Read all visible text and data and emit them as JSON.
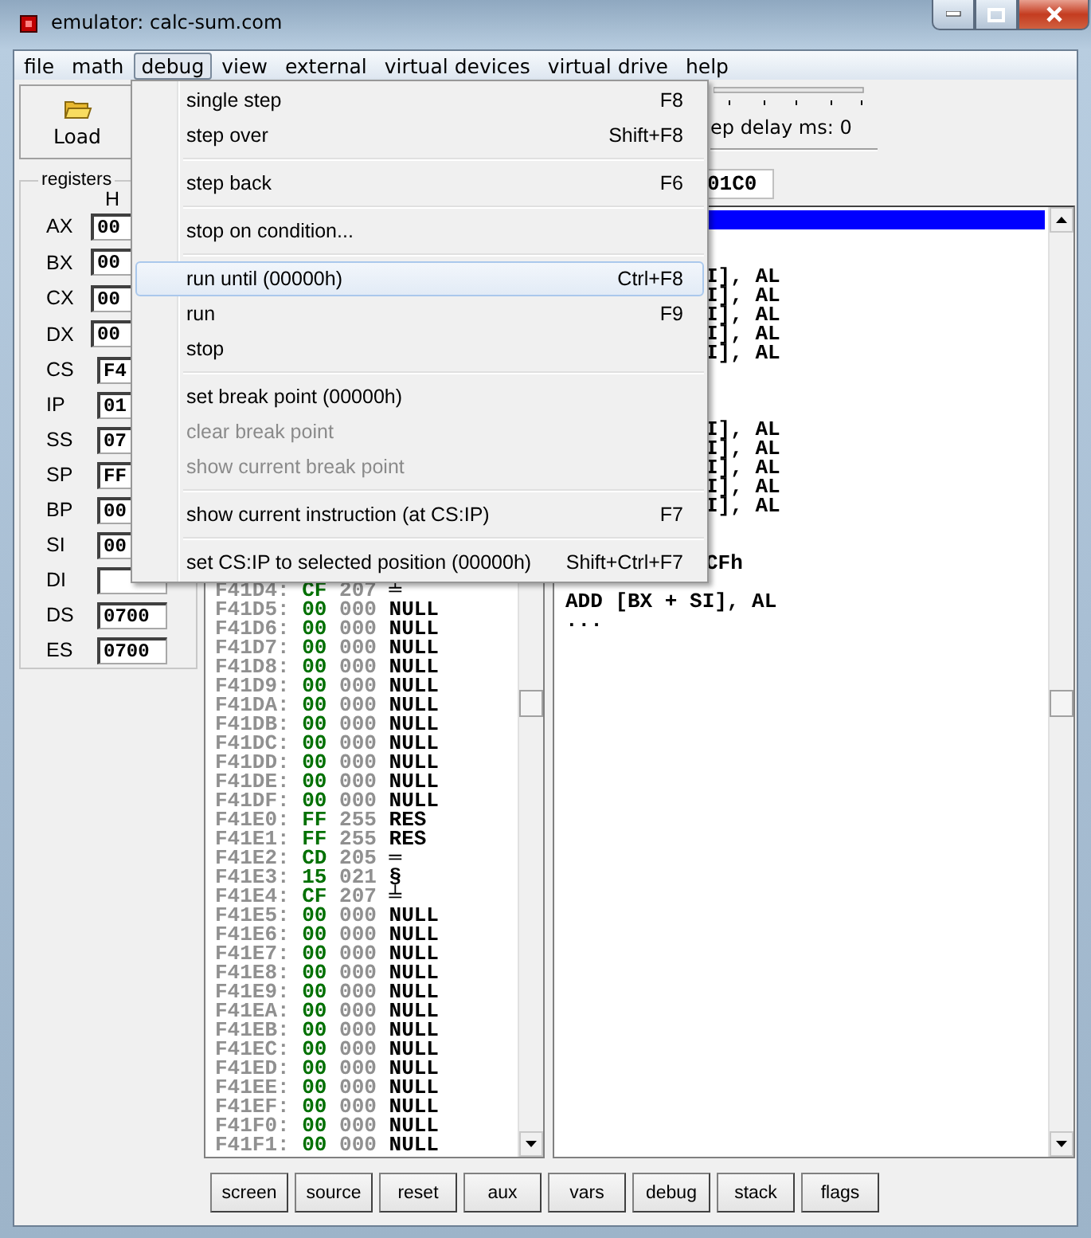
{
  "window": {
    "title": "emulator: calc-sum.com"
  },
  "menubar": [
    {
      "label": "file",
      "selected": false
    },
    {
      "label": "math",
      "selected": false
    },
    {
      "label": "debug",
      "selected": true
    },
    {
      "label": "view",
      "selected": false
    },
    {
      "label": "external",
      "selected": false
    },
    {
      "label": "virtual devices",
      "selected": false
    },
    {
      "label": "virtual drive",
      "selected": false
    },
    {
      "label": "help",
      "selected": false
    }
  ],
  "toolbar": {
    "load_button": "Load",
    "step_delay_label": "ep delay ms: 0",
    "address_value": "01C0"
  },
  "registers": {
    "title": "registers",
    "column_header": "H",
    "rows": [
      {
        "name": "AX",
        "value": "00",
        "kind": "byte"
      },
      {
        "name": "BX",
        "value": "00",
        "kind": "byte"
      },
      {
        "name": "CX",
        "value": "00",
        "kind": "byte"
      },
      {
        "name": "DX",
        "value": "00",
        "kind": "byte"
      },
      {
        "name": "CS",
        "value": "F4",
        "kind": "word"
      },
      {
        "name": "IP",
        "value": "01",
        "kind": "word"
      },
      {
        "name": "SS",
        "value": "07",
        "kind": "word"
      },
      {
        "name": "SP",
        "value": "FF",
        "kind": "word"
      },
      {
        "name": "BP",
        "value": "00",
        "kind": "word"
      },
      {
        "name": "SI",
        "value": "00",
        "kind": "word"
      },
      {
        "name": "DI",
        "kind": "word"
      },
      {
        "name": "DS",
        "value": "0700",
        "kind": "word"
      },
      {
        "name": "ES",
        "value": "0700",
        "kind": "word"
      }
    ]
  },
  "memory": {
    "rows": [
      {
        "address": "F41D4:",
        "hex": "CF",
        "dec": "207",
        "char": "╧"
      },
      {
        "address": "F41D5:",
        "hex": "00",
        "dec": "000",
        "char": "NULL"
      },
      {
        "address": "F41D6:",
        "hex": "00",
        "dec": "000",
        "char": "NULL"
      },
      {
        "address": "F41D7:",
        "hex": "00",
        "dec": "000",
        "char": "NULL"
      },
      {
        "address": "F41D8:",
        "hex": "00",
        "dec": "000",
        "char": "NULL"
      },
      {
        "address": "F41D9:",
        "hex": "00",
        "dec": "000",
        "char": "NULL"
      },
      {
        "address": "F41DA:",
        "hex": "00",
        "dec": "000",
        "char": "NULL"
      },
      {
        "address": "F41DB:",
        "hex": "00",
        "dec": "000",
        "char": "NULL"
      },
      {
        "address": "F41DC:",
        "hex": "00",
        "dec": "000",
        "char": "NULL"
      },
      {
        "address": "F41DD:",
        "hex": "00",
        "dec": "000",
        "char": "NULL"
      },
      {
        "address": "F41DE:",
        "hex": "00",
        "dec": "000",
        "char": "NULL"
      },
      {
        "address": "F41DF:",
        "hex": "00",
        "dec": "000",
        "char": "NULL"
      },
      {
        "address": "F41E0:",
        "hex": "FF",
        "dec": "255",
        "char": "RES"
      },
      {
        "address": "F41E1:",
        "hex": "FF",
        "dec": "255",
        "char": "RES"
      },
      {
        "address": "F41E2:",
        "hex": "CD",
        "dec": "205",
        "char": "═"
      },
      {
        "address": "F41E3:",
        "hex": "15",
        "dec": "021",
        "char": "§"
      },
      {
        "address": "F41E4:",
        "hex": "CF",
        "dec": "207",
        "char": "╧"
      },
      {
        "address": "F41E5:",
        "hex": "00",
        "dec": "000",
        "char": "NULL"
      },
      {
        "address": "F41E6:",
        "hex": "00",
        "dec": "000",
        "char": "NULL"
      },
      {
        "address": "F41E7:",
        "hex": "00",
        "dec": "000",
        "char": "NULL"
      },
      {
        "address": "F41E8:",
        "hex": "00",
        "dec": "000",
        "char": "NULL"
      },
      {
        "address": "F41E9:",
        "hex": "00",
        "dec": "000",
        "char": "NULL"
      },
      {
        "address": "F41EA:",
        "hex": "00",
        "dec": "000",
        "char": "NULL"
      },
      {
        "address": "F41EB:",
        "hex": "00",
        "dec": "000",
        "char": "NULL"
      },
      {
        "address": "F41EC:",
        "hex": "00",
        "dec": "000",
        "char": "NULL"
      },
      {
        "address": "F41ED:",
        "hex": "00",
        "dec": "000",
        "char": "NULL"
      },
      {
        "address": "F41EE:",
        "hex": "00",
        "dec": "000",
        "char": "NULL"
      },
      {
        "address": "F41EF:",
        "hex": "00",
        "dec": "000",
        "char": "NULL"
      },
      {
        "address": "F41F0:",
        "hex": "00",
        "dec": "000",
        "char": "NULL"
      },
      {
        "address": "F41F1:",
        "hex": "00",
        "dec": "000",
        "char": "NULL"
      }
    ]
  },
  "disassembly": {
    "rows": [
      {
        "kind": "covered",
        "selected": true
      },
      {
        "kind": "covered",
        "selected": false
      },
      {
        "kind": "covered",
        "selected": false
      },
      {
        "kind": "tail",
        "text": "I], AL",
        "selected": false
      },
      {
        "kind": "tail",
        "text": "I], AL",
        "selected": false
      },
      {
        "kind": "tail",
        "text": "I], AL",
        "selected": false
      },
      {
        "kind": "tail",
        "text": "I], AL",
        "selected": false
      },
      {
        "kind": "tail",
        "text": "I], AL",
        "selected": false
      },
      {
        "kind": "covered",
        "selected": false
      },
      {
        "kind": "covered",
        "selected": false
      },
      {
        "kind": "covered",
        "selected": false
      },
      {
        "kind": "tail",
        "text": "I], AL",
        "selected": false
      },
      {
        "kind": "tail",
        "text": "I], AL",
        "selected": false
      },
      {
        "kind": "tail",
        "text": "I], AL",
        "selected": false
      },
      {
        "kind": "tail",
        "text": "I], AL",
        "selected": false
      },
      {
        "kind": "tail",
        "text": "I], AL",
        "selected": false
      },
      {
        "kind": "covered",
        "selected": false
      },
      {
        "kind": "covered",
        "selected": false
      },
      {
        "kind": "tail",
        "text": "CFh",
        "selected": false
      },
      {
        "kind": "covered",
        "selected": false
      },
      {
        "kind": "full",
        "text": "ADD [BX + SI], AL",
        "selected": false
      },
      {
        "kind": "full",
        "text": "...",
        "selected": false
      }
    ]
  },
  "debug_menu": [
    {
      "kind": "item",
      "label": "single step",
      "shortcut": "F8",
      "selected": false,
      "disabled": false
    },
    {
      "kind": "item",
      "label": "step over",
      "shortcut": "Shift+F8",
      "selected": false,
      "disabled": false
    },
    {
      "kind": "separator"
    },
    {
      "kind": "item",
      "label": "step back",
      "shortcut": "F6",
      "selected": false,
      "disabled": false
    },
    {
      "kind": "separator"
    },
    {
      "kind": "item",
      "label": "stop on condition...",
      "selected": false,
      "disabled": false
    },
    {
      "kind": "separator"
    },
    {
      "kind": "item",
      "label": "run until (00000h)",
      "shortcut": "Ctrl+F8",
      "selected": true,
      "disabled": false
    },
    {
      "kind": "item",
      "label": "run",
      "shortcut": "F9",
      "selected": false,
      "disabled": false
    },
    {
      "kind": "item",
      "label": "stop",
      "selected": false,
      "disabled": false
    },
    {
      "kind": "separator"
    },
    {
      "kind": "item",
      "label": "set break point (00000h)",
      "selected": false,
      "disabled": false
    },
    {
      "kind": "item",
      "label": "clear break point",
      "selected": false,
      "disabled": true
    },
    {
      "kind": "item",
      "label": "show current break point",
      "selected": false,
      "disabled": true
    },
    {
      "kind": "separator"
    },
    {
      "kind": "item",
      "label": "show current instruction (at CS:IP)",
      "shortcut": "F7",
      "selected": false,
      "disabled": false
    },
    {
      "kind": "separator"
    },
    {
      "kind": "item",
      "label": "set CS:IP to selected position (00000h)",
      "shortcut": "Shift+Ctrl+F7",
      "selected": false,
      "disabled": false
    }
  ],
  "bottom_buttons": [
    "screen",
    "source",
    "reset",
    "aux",
    "vars",
    "debug",
    "stack",
    "flags"
  ]
}
